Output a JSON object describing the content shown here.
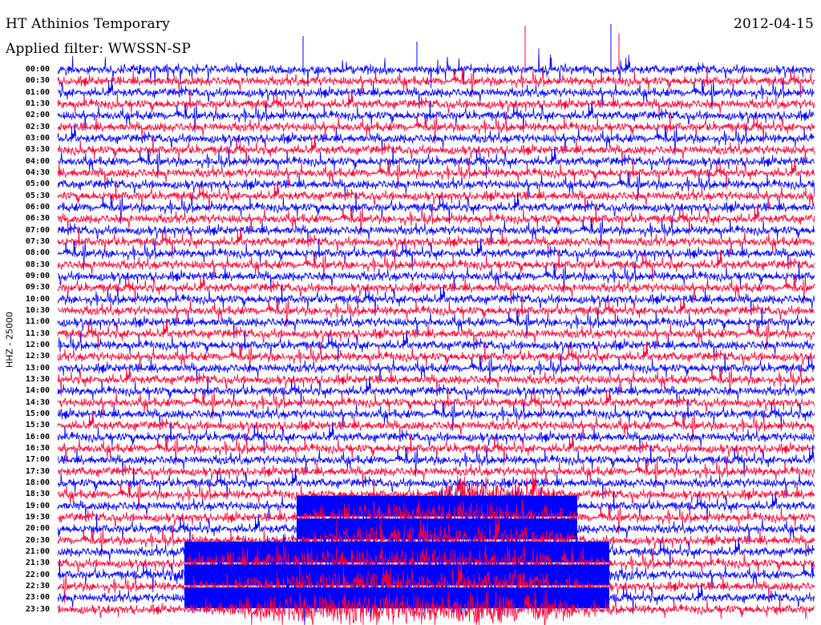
{
  "header": {
    "title": "HT Athinios Temporary",
    "date": "2012-04-15",
    "filter": "Applied filter: WWSSN-SP"
  },
  "side_label": "HHZ - 25000",
  "colors": {
    "trace_a": "#0000ff",
    "trace_b": "#ff0033",
    "background": "#ffffff"
  },
  "chart_data": {
    "type": "line",
    "subtype": "helicorder",
    "title": "HT Athinios Temporary",
    "ylabel": "HHZ - 25000",
    "row_labels": [
      "00:00",
      "00:30",
      "01:00",
      "01:30",
      "02:00",
      "02:30",
      "03:00",
      "03:30",
      "04:00",
      "04:30",
      "05:00",
      "05:30",
      "06:00",
      "06:30",
      "07:00",
      "07:30",
      "08:00",
      "08:30",
      "09:00",
      "09:30",
      "10:00",
      "10:30",
      "11:00",
      "11:30",
      "12:00",
      "12:30",
      "13:00",
      "13:30",
      "14:00",
      "14:30",
      "15:00",
      "15:30",
      "16:00",
      "16:30",
      "17:00",
      "17:30",
      "18:00",
      "18:30",
      "19:00",
      "19:30",
      "20:00",
      "20:30",
      "21:00",
      "21:30",
      "22:00",
      "22:30",
      "23:00",
      "23:30"
    ],
    "series": [
      {
        "color": "#0000ff",
        "rows": "even"
      },
      {
        "color": "#ff0033",
        "rows": "odd"
      }
    ],
    "grid": false
  }
}
